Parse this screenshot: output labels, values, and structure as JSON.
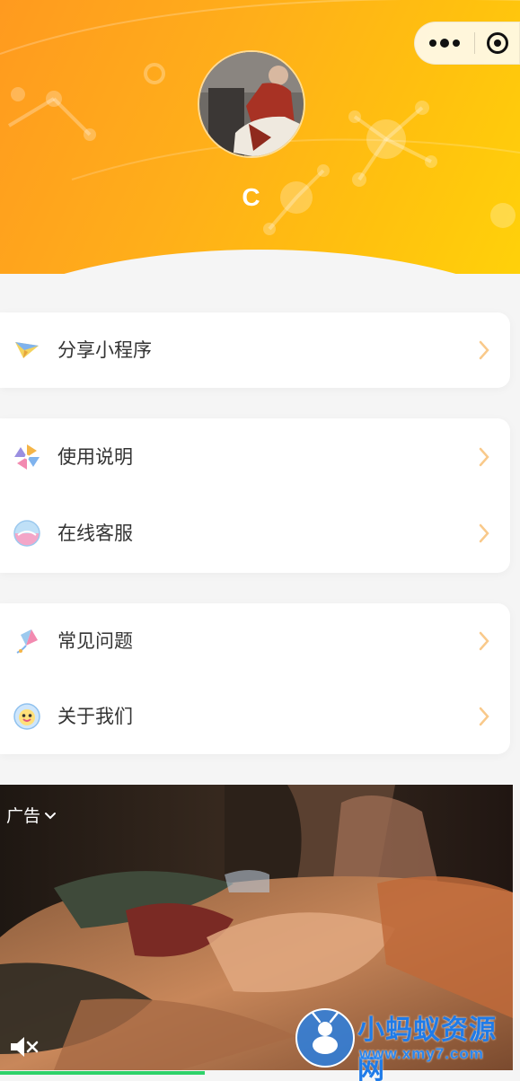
{
  "profile": {
    "username": "C"
  },
  "capsule": {
    "more_icon": "more-dots-icon",
    "close_icon": "target-close-icon"
  },
  "menu_groups": [
    {
      "items": [
        {
          "label": "分享小程序",
          "icon": "paper-plane-icon"
        }
      ]
    },
    {
      "items": [
        {
          "label": "使用说明",
          "icon": "pinwheel-icon"
        },
        {
          "label": "在线客服",
          "icon": "headset-icon"
        }
      ]
    },
    {
      "items": [
        {
          "label": "常见问题",
          "icon": "kite-icon"
        },
        {
          "label": "关于我们",
          "icon": "smiley-icon"
        }
      ]
    }
  ],
  "ad": {
    "label": "广告",
    "mute_icon": "speaker-muted-icon",
    "progress": 0.4
  },
  "watermark": {
    "title": "小蚂蚁资源网",
    "url": "www.xmy7.com"
  },
  "colors": {
    "header_start": "#ff9a1f",
    "header_end": "#ffd10a",
    "chevron": "#f9c98a",
    "progress": "#2fd16a",
    "watermark": "#1f7be8"
  }
}
